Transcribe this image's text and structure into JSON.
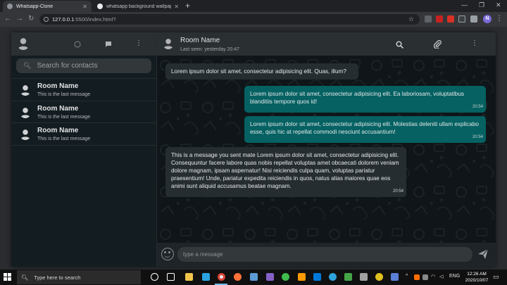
{
  "browser": {
    "tabs": [
      {
        "title": "Whatsapp-Clone",
        "active": true,
        "favicon_color": "#8e9399"
      },
      {
        "title": "whatsapp background wallpaper",
        "active": false,
        "favicon_color": "#e8eaed"
      }
    ],
    "url_host": "127.0.0.1",
    "url_path": ":5500/index.html?"
  },
  "sidebar": {
    "search_placeholder": "Search for contacts",
    "contacts": [
      {
        "name": "Room Name",
        "last": "This is the last message"
      },
      {
        "name": "Room Name",
        "last": "This is the last message"
      },
      {
        "name": "Room Name",
        "last": "This is the last message"
      }
    ]
  },
  "chat": {
    "room_name": "Room Name",
    "last_seen": "Last seen: yesterday 20:47",
    "input_placeholder": "type a message",
    "messages": [
      {
        "direction": "in",
        "text": "Lorem ipsum dolor sit amet, consectetur adipisicing elit. Quas, illum?",
        "time": ""
      },
      {
        "direction": "out",
        "text": "Lorem ipsum dolor sit amet, consectetur adipisicing elit. Ea laboriosam, voluptatibus blanditiis tempore quos id!",
        "time": "20:54"
      },
      {
        "direction": "out",
        "text": "Lorem ipsum dolor sit amet, consectetur adipisicing elit. Molestias deleniti ullam explicabo esse, quis hic at repellat commodi nesciunt accusantium!",
        "time": "20:54"
      },
      {
        "direction": "in",
        "text": "This is a message you sent mate Lorem ipsum dolor sit amet, consectetur adipisicing elit. Consequuntur facere labore quas nobis repellat voluptas amet obcaecati dolorem veniam dolore magnam, ipsam aspernatur! Nisi reiciendis culpa quam, voluptas pariatur praesentium! Unde, pariatur expedita reiciendis in quos, natus alias maiores quae eos animi sunt aliquid accusamus beatae magnam.",
        "time": "20:54"
      }
    ]
  },
  "taskbar": {
    "search_text": "Type here to search",
    "language": "ENG",
    "time": "12:26 AM",
    "date": "2020/10/07"
  },
  "colors": {
    "outgoing_bubble": "#056162",
    "incoming_bubble": "#262d31",
    "header": "#2a2f32",
    "sidebar_bg": "#131c21"
  }
}
